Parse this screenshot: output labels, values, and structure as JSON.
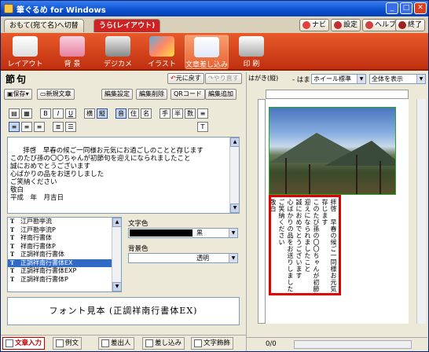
{
  "window": {
    "title": "筆ぐるめ for Windows"
  },
  "tabs": {
    "omote": "おもて(宛て名)へ切替",
    "ura": "うら(レイアウト)"
  },
  "topbuttons": [
    "ナビ",
    "設定",
    "ヘルプ",
    "終了"
  ],
  "ribbon": [
    "レイアウト",
    "背 景",
    "デジカメ",
    "イラスト",
    "文章差し込み",
    "印 刷"
  ],
  "section": {
    "title": "節句"
  },
  "undo": {
    "undo_label": "元に戻す",
    "redo_label": "やり直す"
  },
  "toolbar1": {
    "save": "保存",
    "new_text": "新規文章",
    "edit_settings": "編集設定",
    "delete_edit": "編集削除",
    "qrcode": "QRコード",
    "add_edit": "編集追加"
  },
  "formatbtns": [
    "B",
    "I",
    "U",
    "横",
    "縦",
    "音",
    "住",
    "名",
    "手",
    "半",
    "数"
  ],
  "body_text": "拝啓　早春の候ご一同様お元気にお過ごしのことと存じます\nこのたび孫の〇〇ちゃんが初節句を迎えになられましたこと\n誠におめでとうございます\n心ばかりの品をお送りしました\nご笑納ください\n敬白\n平成　年　月吉日",
  "fonts": [
    "江戸勘亭流",
    "江戸勘亭流P",
    "祥南行書体",
    "祥南行書体P",
    "正調祥南行書体",
    "正調祥南行書体EX",
    "正調祥南行書体EXP",
    "正調祥南行書体P"
  ],
  "selected_font_index": 5,
  "text_color": {
    "label": "文字色",
    "value": "黒",
    "swatch": "#000000"
  },
  "bg_color": {
    "label": "背景色",
    "value": "透明"
  },
  "font_preview": "フォント見本 (正調祥南行書体EX)",
  "bottomtabs": [
    "文章入力",
    "例文",
    "差出人",
    "差し込み",
    "文字飾飾"
  ],
  "right": {
    "card_type": "はがき(縦)",
    "wa": "- はま",
    "pen": "ホイール標準",
    "view": "全体を表示",
    "page": "0/0"
  },
  "card_columns": [
    "拝啓　早春の候ご一同様お元気にお過ごしのことと",
    "存じます",
    "このたび孫の〇〇ちゃんが初節句を",
    "迎えになられましたこと",
    "誠におめでとうございます",
    "心ばかりの品をお送りしました",
    "ご笑納ください",
    "敬白",
    "平成　年　月吉日"
  ],
  "colors": {
    "accent": "#d02020",
    "selection": "#316ac5",
    "frame": "#e00000"
  }
}
